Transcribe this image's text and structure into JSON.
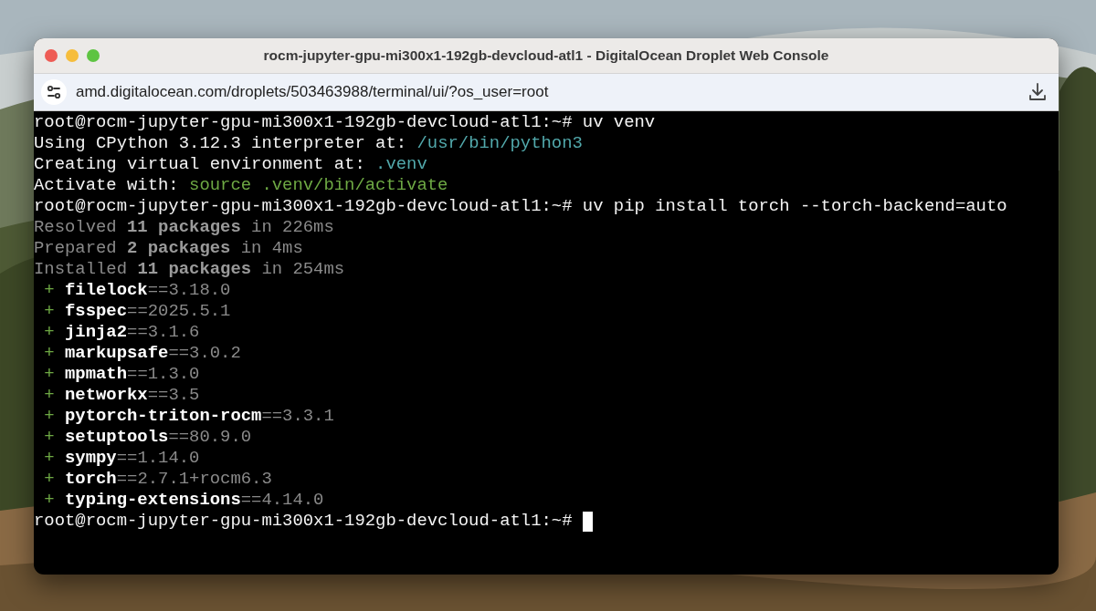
{
  "window": {
    "title": "rocm-jupyter-gpu-mi300x1-192gb-devcloud-atl1 - DigitalOcean Droplet Web Console"
  },
  "address_bar": {
    "url": "amd.digitalocean.com/droplets/503463988/terminal/ui/?os_user=root"
  },
  "terminal": {
    "cursor": true,
    "lines": [
      [
        {
          "kind": "plain",
          "text": "root@rocm-jupyter-gpu-mi300x1-192gb-devcloud-atl1:~# uv venv"
        }
      ],
      [
        {
          "kind": "plain",
          "text": "Using CPython 3.12.3 interpreter at: "
        },
        {
          "kind": "path",
          "text": "/usr/bin/python3"
        }
      ],
      [
        {
          "kind": "plain",
          "text": "Creating virtual environment at: "
        },
        {
          "kind": "path",
          "text": ".venv"
        }
      ],
      [
        {
          "kind": "plain",
          "text": "Activate with: "
        },
        {
          "kind": "green",
          "text": "source .venv/bin/activate"
        }
      ],
      [
        {
          "kind": "plain",
          "text": "root@rocm-jupyter-gpu-mi300x1-192gb-devcloud-atl1:~# uv pip install torch --torch-backend=auto"
        }
      ],
      [
        {
          "kind": "dim",
          "text": "Resolved "
        },
        {
          "kind": "dimbold",
          "text": "11 packages"
        },
        {
          "kind": "dim",
          "text": " in 226ms"
        }
      ],
      [
        {
          "kind": "dim",
          "text": "Prepared "
        },
        {
          "kind": "dimbold",
          "text": "2 packages"
        },
        {
          "kind": "dim",
          "text": " in 4ms"
        }
      ],
      [
        {
          "kind": "dim",
          "text": "Installed "
        },
        {
          "kind": "dimbold",
          "text": "11 packages"
        },
        {
          "kind": "dim",
          "text": " in 254ms"
        }
      ],
      [
        {
          "kind": "green",
          "text": " + "
        },
        {
          "kind": "bold",
          "text": "filelock"
        },
        {
          "kind": "dim",
          "text": "==3.18.0"
        }
      ],
      [
        {
          "kind": "green",
          "text": " + "
        },
        {
          "kind": "bold",
          "text": "fsspec"
        },
        {
          "kind": "dim",
          "text": "==2025.5.1"
        }
      ],
      [
        {
          "kind": "green",
          "text": " + "
        },
        {
          "kind": "bold",
          "text": "jinja2"
        },
        {
          "kind": "dim",
          "text": "==3.1.6"
        }
      ],
      [
        {
          "kind": "green",
          "text": " + "
        },
        {
          "kind": "bold",
          "text": "markupsafe"
        },
        {
          "kind": "dim",
          "text": "==3.0.2"
        }
      ],
      [
        {
          "kind": "green",
          "text": " + "
        },
        {
          "kind": "bold",
          "text": "mpmath"
        },
        {
          "kind": "dim",
          "text": "==1.3.0"
        }
      ],
      [
        {
          "kind": "green",
          "text": " + "
        },
        {
          "kind": "bold",
          "text": "networkx"
        },
        {
          "kind": "dim",
          "text": "==3.5"
        }
      ],
      [
        {
          "kind": "green",
          "text": " + "
        },
        {
          "kind": "bold",
          "text": "pytorch-triton-rocm"
        },
        {
          "kind": "dim",
          "text": "==3.3.1"
        }
      ],
      [
        {
          "kind": "green",
          "text": " + "
        },
        {
          "kind": "bold",
          "text": "setuptools"
        },
        {
          "kind": "dim",
          "text": "==80.9.0"
        }
      ],
      [
        {
          "kind": "green",
          "text": " + "
        },
        {
          "kind": "bold",
          "text": "sympy"
        },
        {
          "kind": "dim",
          "text": "==1.14.0"
        }
      ],
      [
        {
          "kind": "green",
          "text": " + "
        },
        {
          "kind": "bold",
          "text": "torch"
        },
        {
          "kind": "dim",
          "text": "==2.7.1+rocm6.3"
        }
      ],
      [
        {
          "kind": "green",
          "text": " + "
        },
        {
          "kind": "bold",
          "text": "typing-extensions"
        },
        {
          "kind": "dim",
          "text": "==4.14.0"
        }
      ],
      [
        {
          "kind": "plain",
          "text": "root@rocm-jupyter-gpu-mi300x1-192gb-devcloud-atl1:~# "
        }
      ]
    ]
  }
}
